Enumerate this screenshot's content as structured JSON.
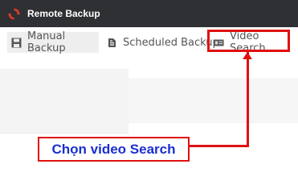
{
  "app": {
    "title": "Remote Backup",
    "logo_icon": "refresh-icon"
  },
  "tabs": [
    {
      "label": "Manual Backup",
      "icon": "save-icon",
      "active": true
    },
    {
      "label": "Scheduled Backup",
      "icon": "schedule-document-icon",
      "active": false
    },
    {
      "label": "Video Search",
      "icon": "video-card-icon",
      "active": false
    }
  ],
  "annotation": {
    "label": "Chọn video Search",
    "target": "Video Search"
  },
  "colors": {
    "titlebar": "#2f3033",
    "logo": "#e53a2a",
    "highlight": "#e01010",
    "callout_text": "#1a2fd0",
    "tab_text": "#555555",
    "active_tab_bg": "#eeeeee"
  }
}
